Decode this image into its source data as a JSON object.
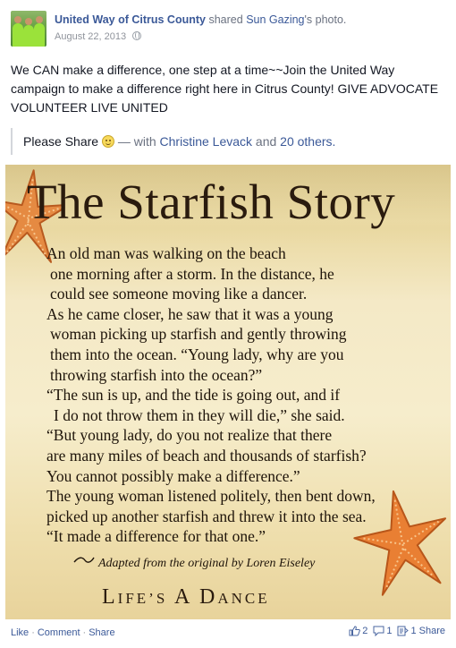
{
  "post": {
    "actor": "United Way of Citrus County",
    "verb": "shared",
    "source": "Sun Gazing",
    "source_suffix": "'s photo.",
    "date": "August 22, 2013",
    "message": "We CAN make a difference, one step at a time~~Join the United Way campaign to make a difference right here in Citrus County! GIVE ADVOCATE VOLUNTEER LIVE UNITED",
    "tag_text": "Please Share",
    "tag_with": "— with",
    "tag_person": "Christine Levack",
    "tag_and": "and",
    "tag_others": "20 others."
  },
  "photo": {
    "title": "The Starfish Story",
    "lines": [
      "An old man was walking on  the beach",
      "one morning after a storm. In the distance, he",
      "could see someone moving like a dancer.",
      "As he came closer, he saw that it was a young",
      "woman picking up starfish and gently throwing",
      "them into the ocean.  “Young lady, why are you",
      "throwing starfish  into the ocean?”",
      "“The sun is up, and the tide is going out, and if",
      "I do not throw them in they will die,” she said.",
      "“But young lady, do you not realize that there",
      "are many miles of beach and thousands of starfish?",
      "You cannot possibly make a difference.”",
      "The young woman listened politely, then bent down,",
      "picked up another starfish and threw it into the sea.",
      "“It made a difference for that one.”"
    ],
    "attribution": "Adapted from the original by Loren Eiseley",
    "tagline_l": "L",
    "tagline_ife": "IFE",
    "tagline_apos": "’",
    "tagline_s": "S",
    "tagline_a": "A",
    "tagline_d": "D",
    "tagline_ance": "ANCE"
  },
  "footer": {
    "like": "Like",
    "comment": "Comment",
    "share": "Share",
    "sep": "·",
    "likes_count": "2",
    "comments_count": "1",
    "shares_count": "1 Share"
  },
  "colors": {
    "link": "#3b5998",
    "muted": "#90949c",
    "starfish": "#e8823a"
  },
  "icons": [
    "globe-icon",
    "smiley-emoticon-icon",
    "thumbs-up-icon",
    "comment-icon",
    "share-icon",
    "starfish-icon"
  ]
}
